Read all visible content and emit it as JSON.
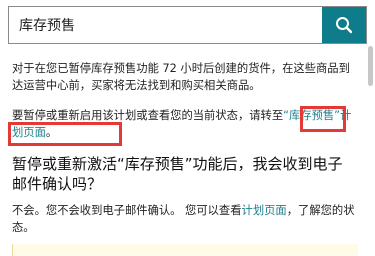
{
  "search": {
    "value": "库存预售",
    "placeholder": ""
  },
  "article": {
    "paragraph1": "对于在您已暂停库存预售功能 72 小时后创建的货件，在这些商品到达运营中心前，买家将无法找到和购买相关商品。",
    "paragraph2_prefix": "要暂停或重新启用该计划或查看您的当前状态，请转至",
    "paragraph2_link": "“库存预售”计划页面",
    "paragraph2_suffix": "。",
    "faq_question": "暂停或重新激活“库存预售”功能后，我会收到电子邮件确认吗？",
    "faq_answer_prefix": "不会。您不会收到电子邮件确认。 您可以查看",
    "faq_answer_link": "计划页面",
    "faq_answer_suffix": "，了解您的状态。"
  },
  "colors": {
    "accent": "#0f7c8b",
    "link": "#1a7f8c",
    "highlight": "#e53935"
  },
  "icons": {
    "search": "search-icon"
  }
}
